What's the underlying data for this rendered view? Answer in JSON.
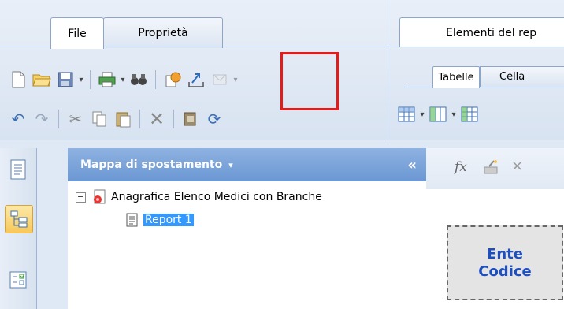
{
  "ribbon": {
    "tabs": [
      {
        "label": "File",
        "active": true
      },
      {
        "label": "Proprietà",
        "active": false
      }
    ],
    "right_group_title": "Elementi del rep",
    "right_tabs": [
      {
        "label": "Tabelle",
        "active": true
      },
      {
        "label": "Cella",
        "active": false
      }
    ]
  },
  "map_panel": {
    "title": "Mappa di spostamento",
    "dropdown_glyph": "▾",
    "collapse_glyph": "«",
    "tree": {
      "document": "Anagrafica Elenco Medici con Branche",
      "report": "Report 1"
    }
  },
  "formula_bar": {
    "fx_glyph": "fx",
    "cancel_glyph": "×"
  },
  "report_cell": {
    "line1": "Ente",
    "line2": "Codice"
  },
  "colors": {
    "highlight": "#e21b1b",
    "header_blue": "#6b97d3",
    "selection": "#3399ff",
    "cell_text": "#1f4fbf"
  }
}
